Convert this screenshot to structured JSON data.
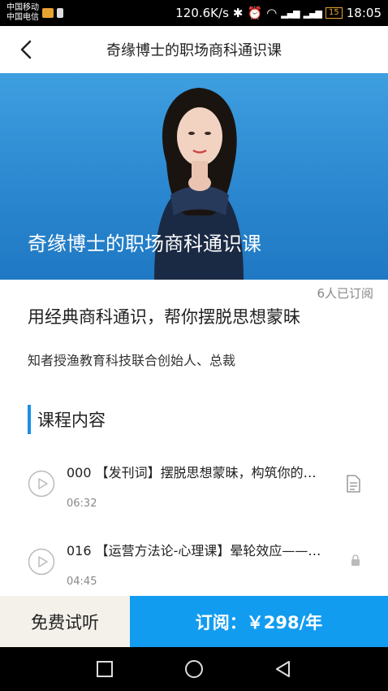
{
  "status_bar": {
    "carrier_1": "中国移动",
    "carrier_2": "中国电信",
    "net_speed": "120.6K/s",
    "battery": "15",
    "time": "18:05"
  },
  "nav": {
    "title": "奇缘博士的职场商科通识课"
  },
  "hero": {
    "title": "奇缘博士的职场商科通识课"
  },
  "course": {
    "subscribers": "6人已订阅",
    "headline": "用经典商科通识，帮你摆脱思想蒙昧",
    "author_desc": "知者授渔教育科技联合创始人、总裁",
    "section_heading": "课程内容",
    "lessons": [
      {
        "title": "000 【发刊词】摆脱思想蒙昧，构筑你的…",
        "duration": "06:32",
        "icon": "document-icon"
      },
      {
        "title": "016 【运营方法论-心理课】晕轮效应——…",
        "duration": "04:45",
        "icon": "lock-icon"
      }
    ]
  },
  "actions": {
    "trial_label": "免费试听",
    "subscribe_label": "订阅：￥298/年"
  },
  "colors": {
    "accent": "#129cf0",
    "section_bar": "#1a8fe8",
    "trial_bg": "#f4f1ea"
  }
}
